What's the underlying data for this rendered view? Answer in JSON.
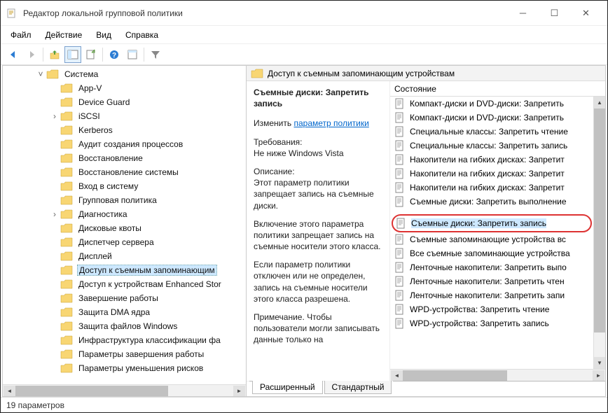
{
  "window": {
    "title": "Редактор локальной групповой политики"
  },
  "menu": {
    "file": "Файл",
    "action": "Действие",
    "view": "Вид",
    "help": "Справка"
  },
  "tree": {
    "root": "Система",
    "items": [
      "App-V",
      "Device Guard",
      "iSCSI",
      "Kerberos",
      "Аудит создания процессов",
      "Восстановление",
      "Восстановление системы",
      "Вход в систему",
      "Групповая политика",
      "Диагностика",
      "Дисковые квоты",
      "Диспетчер сервера",
      "Дисплей",
      "Доступ к съемным запоминающим",
      "Доступ к устройствам Enhanced Stor",
      "Завершение работы",
      "Защита DMA ядра",
      "Защита файлов Windows",
      "Инфраструктура классификации фа",
      "Параметры завершения работы",
      "Параметры уменьшения рисков"
    ],
    "selected_index": 13,
    "expandable": [
      2,
      9
    ]
  },
  "panel": {
    "header": "Доступ к съемным запоминающим устройствам",
    "col_state": "Состояние",
    "desc": {
      "title": "Cъемные диски: Запретить запись",
      "edit_label": "Изменить",
      "edit_link": "параметр политики",
      "req_label": "Требования:",
      "req_text": "Не ниже Windows Vista",
      "desc_label": "Описание:",
      "desc_p1": "Этот параметр политики запрещает запись на съемные диски.",
      "desc_p2": "Включение этого параметра политики запрещает запись на съемные носители этого класса.",
      "desc_p3": "Если параметр политики отключен или не определен, запись на съемные носители этого класса разрешена.",
      "desc_p4": "Примечание. Чтобы пользователи могли записывать данные только на"
    },
    "policies": [
      "Компакт-диски и DVD-диски: Запретить",
      "Компакт-диски и DVD-диски: Запретить",
      "Специальные классы: Запретить чтение",
      "Специальные классы: Запретить запись",
      "Накопители на гибких дисках: Запретит",
      "Накопители на гибких дисках: Запретит",
      "Накопители на гибких дисках: Запретит",
      "Cъемные диски: Запретить выполнение",
      "Cъемные диски: Запретить запись",
      "Съемные запоминающие устройства вс",
      "Все съемные запоминающие устройства",
      "Ленточные накопители: Запретить выпо",
      "Ленточные накопители: Запретить чтен",
      "Ленточные накопители: Запретить запи",
      "WPD-устройства: Запретить чтение",
      "WPD-устройства: Запретить запись"
    ],
    "highlight_index": 8
  },
  "tabs": {
    "ext": "Расширенный",
    "std": "Стандартный"
  },
  "status": "19 параметров"
}
